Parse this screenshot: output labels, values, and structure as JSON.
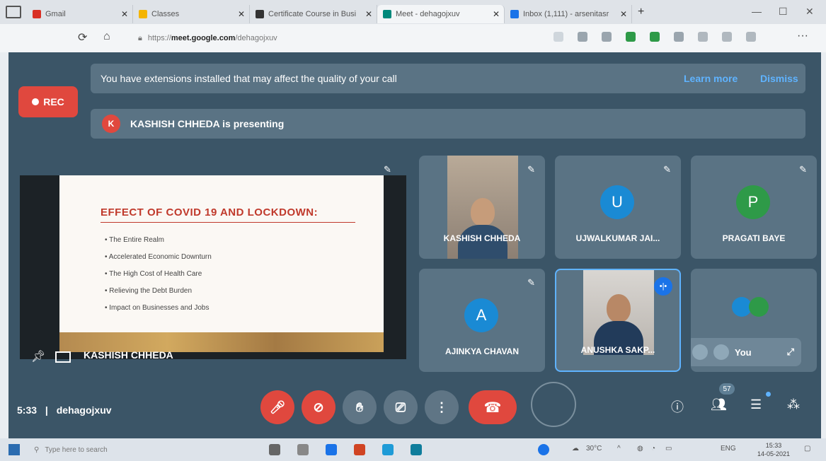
{
  "browser": {
    "tabs": [
      {
        "label": "Gmail",
        "color": "#d93025"
      },
      {
        "label": "Classes",
        "color": "#f4b400"
      },
      {
        "label": "Certificate Course in Busi",
        "color": "#333333"
      },
      {
        "label": "Meet - dehagojxuv",
        "color": "#00897b"
      },
      {
        "label": "Inbox (1,111) - arsenitasr",
        "color": "#1a73e8"
      }
    ],
    "url_prefix": "https://",
    "url_host": "meet.google.com",
    "url_path": "/dehagojxuv"
  },
  "meet": {
    "banner_text": "You have extensions installed that may affect the quality of your call",
    "banner_learn_more": "Learn more",
    "banner_dismiss": "Dismiss",
    "rec_label": "REC",
    "presenter_initial": "K",
    "presenting_text": "KASHISH CHHEDA is presenting",
    "presenter_caption": "KASHISH CHHEDA",
    "slide": {
      "title": "EFFECT OF COVID 19 AND LOCKDOWN:",
      "bullets": [
        "The Entire Realm",
        "Accelerated Economic Downturn",
        "The High Cost of Health Care",
        "Relieving the Debt Burden",
        "Impact on Businesses and Jobs"
      ]
    },
    "participants": [
      {
        "name": "KASHISH CHHEDA",
        "initial": "",
        "color": ""
      },
      {
        "name": "UJWALKUMAR JAI...",
        "initial": "U",
        "color": "#1a8ad4"
      },
      {
        "name": "PRAGATI BAYE",
        "initial": "P",
        "color": "#2e9a48"
      },
      {
        "name": "AJINKYA CHAVAN",
        "initial": "A",
        "color": "#1a8ad4"
      },
      {
        "name": "ANUSHKA SAKP...",
        "initial": "",
        "color": ""
      }
    ],
    "self_label": "You",
    "time": "5:33",
    "meeting_code": "dehagojxuv",
    "people_count": "57"
  },
  "taskbar": {
    "search_placeholder": "Type here to search",
    "weather": "30°C",
    "lang": "ENG",
    "time": "15:33",
    "date": "14-05-2021"
  }
}
